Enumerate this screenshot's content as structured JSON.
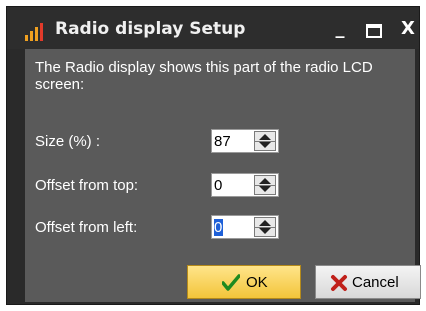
{
  "window": {
    "title": "Radio display Setup",
    "controls": {
      "minimize": "_",
      "close": "X"
    }
  },
  "description": "The Radio display shows this part of the radio LCD screen:",
  "fields": [
    {
      "label": "Size (%) :",
      "value": "87"
    },
    {
      "label": "Offset from top:",
      "value": "0"
    },
    {
      "label": "Offset from left:",
      "value": "0"
    }
  ],
  "buttons": {
    "ok": "OK",
    "cancel": "Cancel"
  },
  "colors": {
    "client_bg": "#5a5a5a",
    "title_bg": "#2d2d2d",
    "ok_button": "#f3c53a",
    "app_icon": "#f0a020"
  },
  "icons": {
    "app": "signal-bars-icon",
    "ok": "check-icon",
    "cancel": "cross-icon"
  }
}
